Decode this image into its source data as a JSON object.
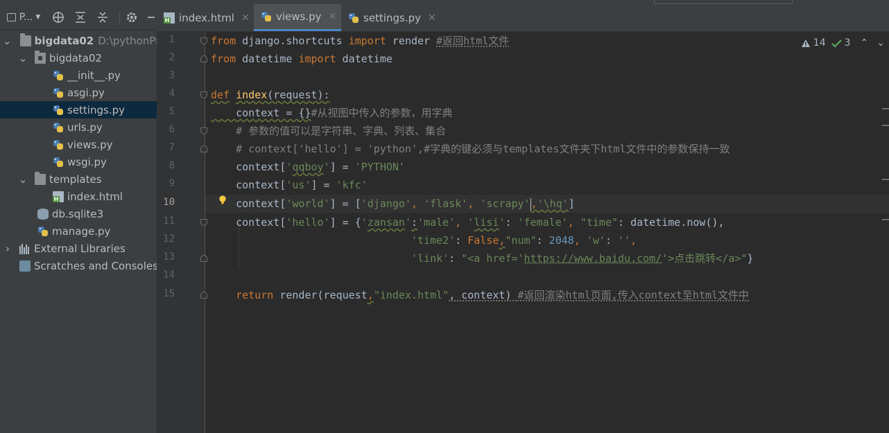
{
  "sidebar": {
    "toolbar": {
      "project_label": "P..."
    },
    "tree": [
      {
        "label": "bigdata02",
        "extra": "D:\\pythonPro",
        "type": "project"
      },
      {
        "label": "bigdata02",
        "type": "package"
      },
      {
        "label": "__init__.py",
        "type": "py"
      },
      {
        "label": "asgi.py",
        "type": "py"
      },
      {
        "label": "settings.py",
        "type": "py",
        "selected": true
      },
      {
        "label": "urls.py",
        "type": "py"
      },
      {
        "label": "views.py",
        "type": "py"
      },
      {
        "label": "wsgi.py",
        "type": "py"
      },
      {
        "label": "templates",
        "type": "folder"
      },
      {
        "label": "index.html",
        "type": "html"
      },
      {
        "label": "db.sqlite3",
        "type": "db"
      },
      {
        "label": "manage.py",
        "type": "py"
      },
      {
        "label": "External Libraries",
        "type": "lib"
      },
      {
        "label": "Scratches and Consoles",
        "type": "scratch"
      }
    ]
  },
  "tabs": [
    {
      "label": "index.html",
      "icon": "html-file-icon"
    },
    {
      "label": "views.py",
      "icon": "python-file-icon",
      "active": true
    },
    {
      "label": "settings.py",
      "icon": "python-file-icon"
    }
  ],
  "inspections": {
    "warnings": "14",
    "weak_warnings": "3"
  },
  "line_numbers": [
    "1",
    "2",
    "3",
    "4",
    "5",
    "6",
    "7",
    "8",
    "9",
    "10",
    "11",
    "12",
    "13",
    "14",
    "15"
  ],
  "current_line": "10",
  "code": {
    "l1": {
      "a": "from",
      "b": " django.shortcuts ",
      "c": "import",
      "d": " render ",
      "e": "#返回html文件"
    },
    "l2": {
      "a": "from",
      "b": " datetime ",
      "c": "import",
      "d": " datetime"
    },
    "l4": {
      "a": "def",
      "b": " ",
      "c": "index",
      "d": "(request):"
    },
    "l5": {
      "a": "    context = {}",
      "b": "#从视图中传入的参数，用字典"
    },
    "l6": {
      "a": "    # 参数的值可以是字符串、字典、列表、集合"
    },
    "l7": {
      "a": "    # context['hello'] = 'python',#字典的键必须与templates文件夹下html文件中的参数保持一致"
    },
    "l8": {
      "a": "    context[",
      "b": "'",
      "c": "qqboy",
      "d": "'",
      "e": "] = ",
      "f": "'PYTHON'"
    },
    "l9": {
      "a": "    context[",
      "b": "'us'",
      "c": "] = ",
      "d": "'kfc'"
    },
    "l10": {
      "a": "    context[",
      "b": "'world'",
      "c": "] = [",
      "d": "'django'",
      "e": ", ",
      "f": "'flask'",
      "g": ", ",
      "h": "'scrapy'",
      "i": ",",
      "j": "'\\hq'",
      "k": "]"
    },
    "l11": {
      "a": "    context[",
      "b": "'hello'",
      "c": "] = {",
      "d": "'",
      "e": "zansan",
      "f": "'",
      "g": ":",
      "h": "'male'",
      "i": ", ",
      "j": "'",
      "k": "lisi",
      "l": "'",
      "m": ": ",
      "n": "'female'",
      "o": ", ",
      "p": "\"time\"",
      "q": ": datetime.now(),"
    },
    "l12": {
      "a": "                                ",
      "b": "'time2'",
      "c": ": ",
      "d": "False",
      "e": ",",
      "f": "\"num\"",
      "g": ": ",
      "h": "2048",
      "i": ", ",
      "j": "'w'",
      "k": ": ",
      "l": "''",
      "m": ","
    },
    "l13": {
      "a": "                                ",
      "b": "'link'",
      "c": ": ",
      "d": "\"<a href='",
      "e": "https://www.baidu.com/",
      "f": "'>点击跳转</a>\"",
      "g": "}"
    },
    "l15": {
      "a": "    ",
      "b": "return",
      "c": " render(request",
      "d": ",",
      "e": "\"index.html\"",
      "f": ", context) ",
      "g": "#返回渲染html页面,传入context至html文件中"
    }
  },
  "colors": {
    "keyword": "#cc7832",
    "string": "#6a8759",
    "number": "#6897bb",
    "comment": "#808080",
    "function": "#ffc66d",
    "text": "#a9b7c6",
    "selection": "#0d293e",
    "tab_underline": "#4a88c7"
  }
}
